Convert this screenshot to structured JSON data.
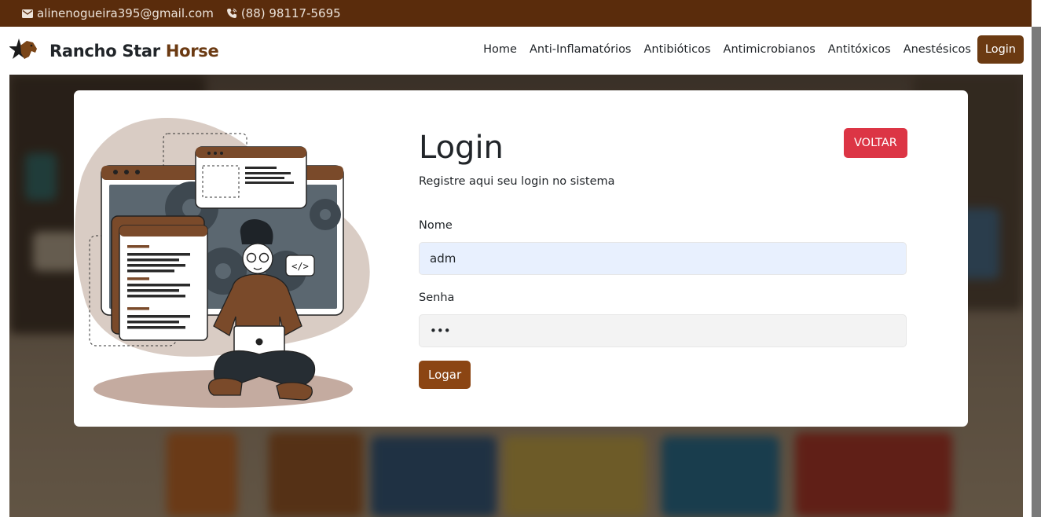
{
  "topbar": {
    "email": "alinenogueira395@gmail.com",
    "phone": "(88) 98117-5695",
    "email_icon": "envelope-icon",
    "phone_icon": "phone-icon"
  },
  "navbar": {
    "brand_main": "Rancho Star",
    "brand_accent": "Horse",
    "logo_icon": "star-horse-logo",
    "links": [
      "Home",
      "Anti-Inflamatórios",
      "Antibióticos",
      "Antimicrobianos",
      "Antitóxicos",
      "Anestésicos"
    ],
    "login_label": "Login"
  },
  "modal": {
    "title": "Login",
    "subtitle": "Registre aqui seu login no sistema",
    "voltar_label": "VOLTAR",
    "name_label": "Nome",
    "name_value": "adm",
    "password_label": "Senha",
    "password_value": "•••",
    "submit_label": "Logar"
  },
  "colors": {
    "topbar": "#5a2c0c",
    "brand_accent": "#6b3a12",
    "danger": "#dc3545",
    "submit": "#8b4513",
    "autofill": "#e8f0fe"
  }
}
